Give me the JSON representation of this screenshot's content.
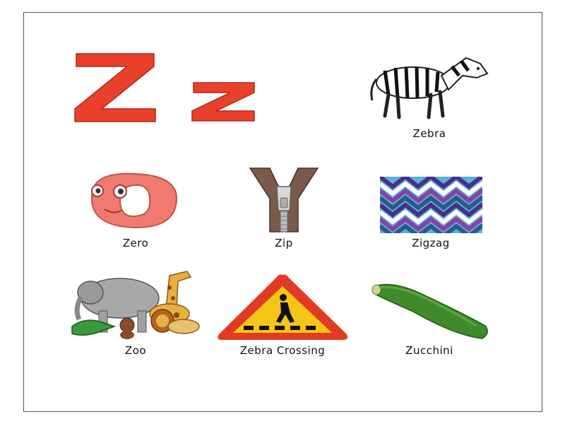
{
  "letters": {
    "upper": "Z",
    "lower": "z"
  },
  "items": [
    {
      "label": "Zebra",
      "icon": "zebra-icon"
    },
    {
      "label": "Zero",
      "icon": "zero-icon"
    },
    {
      "label": "Zip",
      "icon": "zip-icon"
    },
    {
      "label": "Zigzag",
      "icon": "zigzag-icon"
    },
    {
      "label": "Zoo",
      "icon": "zoo-icon"
    },
    {
      "label": "Zebra Crossing",
      "icon": "zebra-crossing-sign-icon"
    },
    {
      "label": "Zucchini",
      "icon": "zucchini-icon"
    }
  ],
  "colors": {
    "letter": "#e8402a",
    "zero": "#f07a70",
    "zip": "#7a5a4a",
    "sign_border": "#e23b25",
    "sign_fill": "#f5c518",
    "zucchini": "#3f8a2a",
    "zigzag": [
      "#4a2e8a",
      "#5bb0d8",
      "#8a3fa8",
      "#2a5a8a"
    ]
  }
}
